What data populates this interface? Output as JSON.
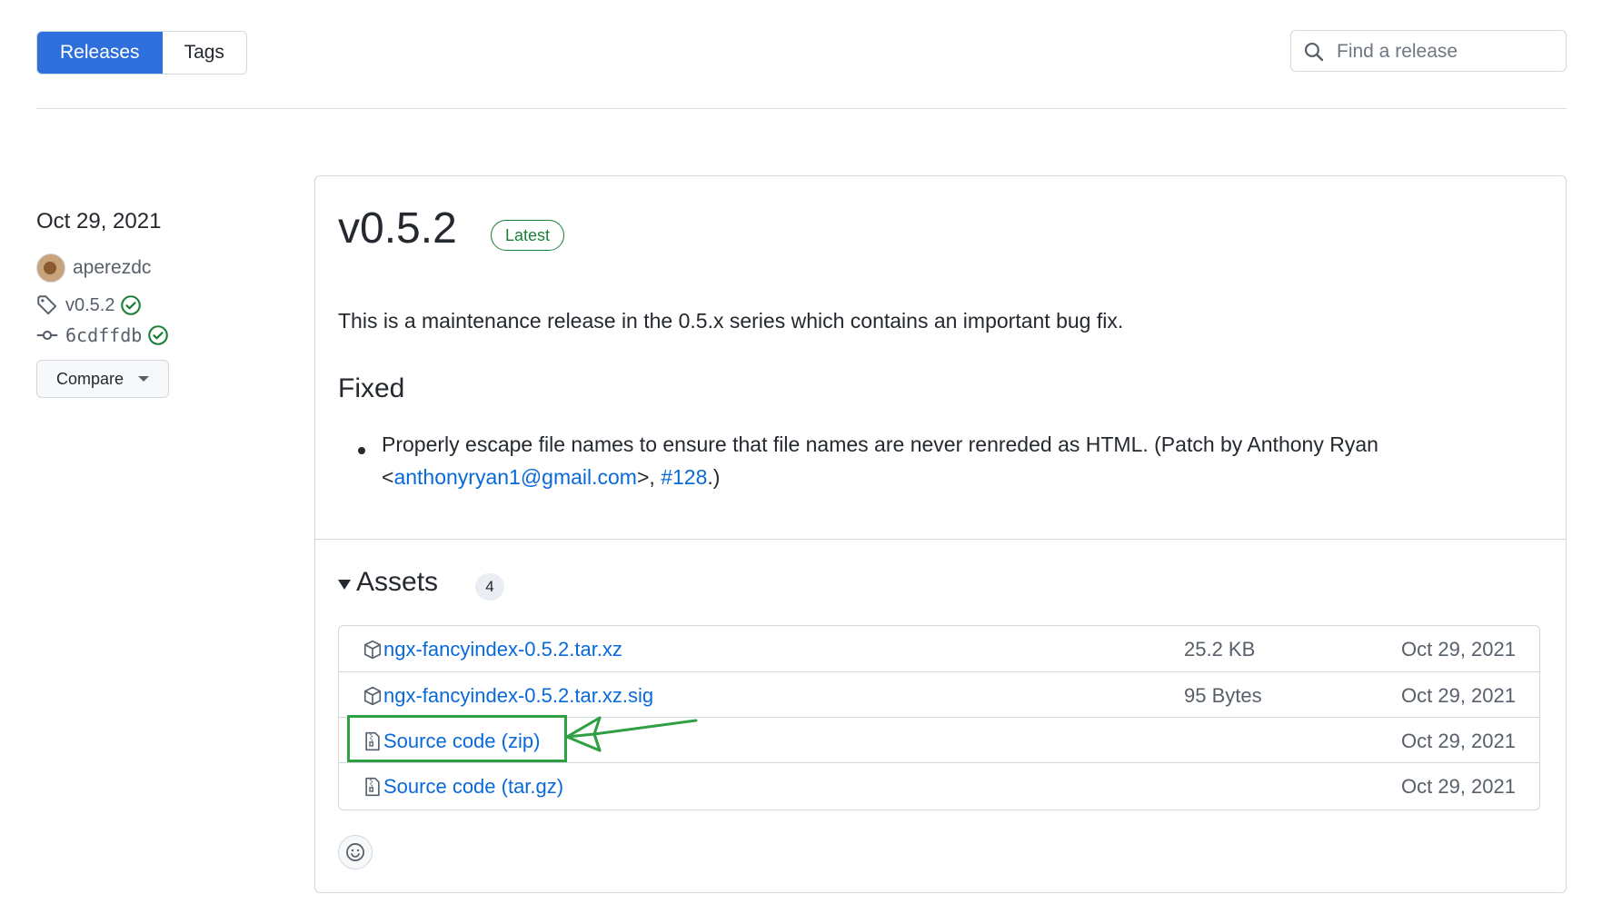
{
  "nav": {
    "tabs": [
      {
        "label": "Releases",
        "active": true
      },
      {
        "label": "Tags",
        "active": false
      }
    ],
    "search_placeholder": "Find a release"
  },
  "sidebar": {
    "date": "Oct 29, 2021",
    "author": "aperezdc",
    "tag": "v0.5.2",
    "commit": "6cdffdb",
    "compare_label": "Compare"
  },
  "release": {
    "title": "v0.5.2",
    "badge": "Latest",
    "description": "This is a maintenance release in the 0.5.x series which contains an important bug fix.",
    "section_heading": "Fixed",
    "fix_line1": "Properly escape file names to ensure that file names are never renreded as HTML. (Patch by Anthony Ryan",
    "fix_line2_prefix": "<",
    "fix_email": "anthonyryan1@gmail.com",
    "fix_mid": ">, ",
    "fix_issue": "#128",
    "fix_suffix": ".)"
  },
  "assets": {
    "heading": "Assets",
    "count": "4",
    "rows": [
      {
        "icon": "package-icon",
        "name": "ngx-fancyindex-0.5.2.tar.xz",
        "size": "25.2 KB",
        "date": "Oct 29, 2021"
      },
      {
        "icon": "package-icon",
        "name": "ngx-fancyindex-0.5.2.tar.xz.sig",
        "size": "95 Bytes",
        "date": "Oct 29, 2021"
      },
      {
        "icon": "file-zip-icon",
        "name": "Source code (zip)",
        "size": "",
        "date": "Oct 29, 2021"
      },
      {
        "icon": "file-zip-icon",
        "name": "Source code (tar.gz)",
        "size": "",
        "date": "Oct 29, 2021"
      }
    ]
  },
  "colors": {
    "accent": "#2f6fdc",
    "link": "#0969da",
    "success": "#1a7f37",
    "annotation": "#2ea043"
  }
}
